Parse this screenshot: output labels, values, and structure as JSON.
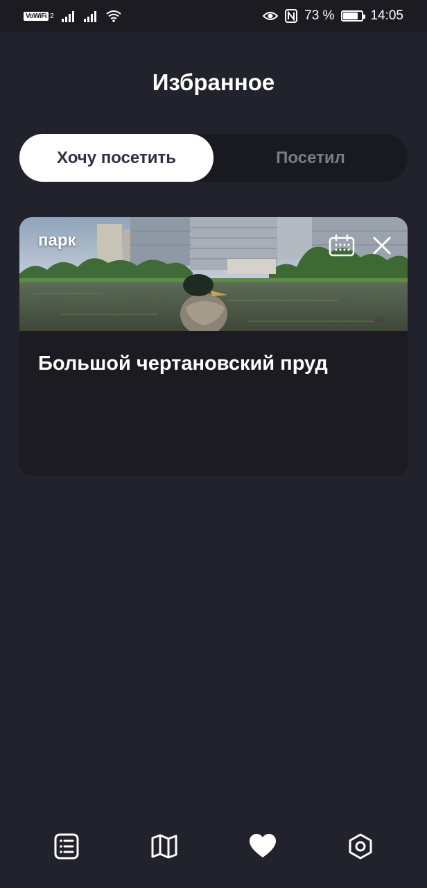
{
  "status_bar": {
    "vowifi": "VoWiFi",
    "sim_number": "2",
    "battery_text": "73 %",
    "battery_level": 0.73,
    "time": "14:05",
    "icons": [
      "signal-icon",
      "signal-icon",
      "wifi-icon",
      "eye-icon",
      "nfc-icon",
      "battery-icon"
    ]
  },
  "header": {
    "title": "Избранное"
  },
  "tabs": {
    "active": "Хочу посетить",
    "inactive": "Посетил"
  },
  "card": {
    "tag": "парк",
    "title": "Большой чертановский пруд",
    "image": "pond-photo",
    "actions": [
      "calendar-icon",
      "close-icon"
    ]
  },
  "bottom_nav": {
    "items": [
      "list-icon",
      "map-icon",
      "heart-icon",
      "settings-icon"
    ],
    "active": "heart-icon"
  },
  "colors": {
    "background": "#22222c",
    "card": "#1b1b21",
    "tab_active_bg": "#ffffff",
    "tab_active_text": "#2f2f45",
    "tab_inactive_text": "#7c7c88"
  }
}
